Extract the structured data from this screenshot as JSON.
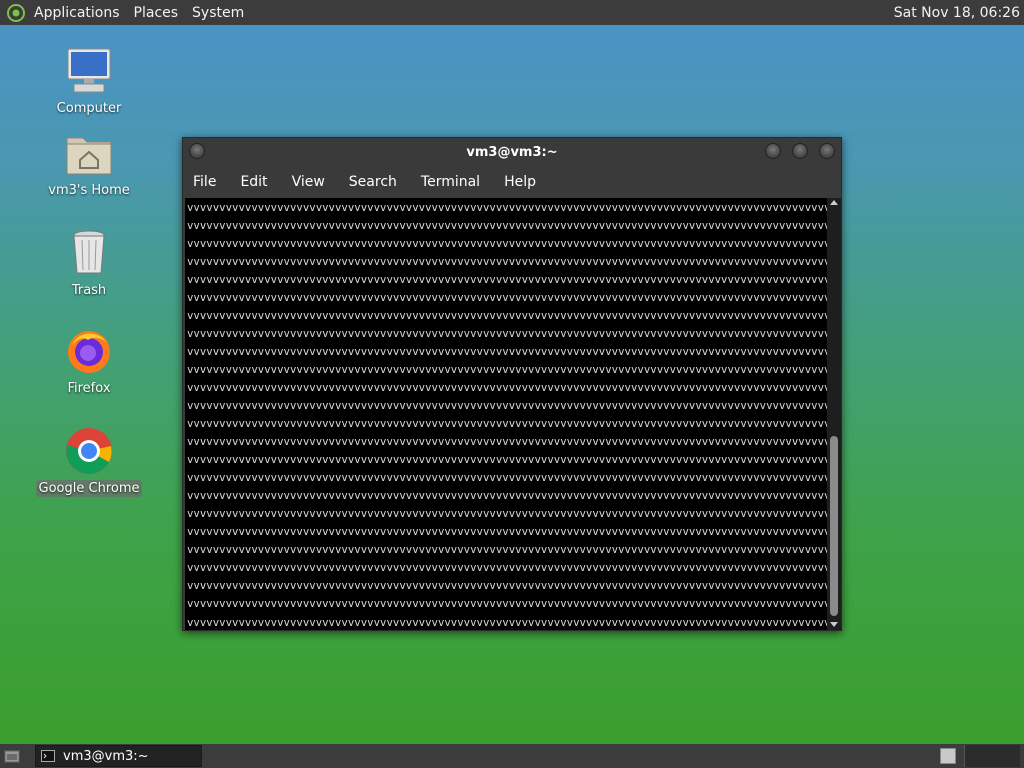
{
  "top_panel": {
    "menus": [
      "Applications",
      "Places",
      "System"
    ],
    "clock": "Sat Nov 18, 06:26"
  },
  "desktop_icons": [
    {
      "label": "Computer",
      "icon": "computer-icon"
    },
    {
      "label": "vm3's Home",
      "icon": "home-folder-icon"
    },
    {
      "label": "Trash",
      "icon": "trash-icon"
    },
    {
      "label": "Firefox",
      "icon": "firefox-icon"
    },
    {
      "label": "Google Chrome",
      "icon": "chrome-icon",
      "selected": true
    }
  ],
  "terminal": {
    "title": "vm3@vm3:~",
    "menus": [
      "File",
      "Edit",
      "View",
      "Search",
      "Terminal",
      "Help"
    ],
    "output_char": "v",
    "full_lines": 23,
    "chars_per_line": 120,
    "last_line_chars": 109
  },
  "taskbar": {
    "items": [
      {
        "label": "vm3@vm3:~",
        "icon": "terminal-icon"
      }
    ]
  },
  "colors": {
    "panel": "#3c3c3c",
    "terminal_bg": "#000000",
    "terminal_fg": "#dcdcdc"
  }
}
